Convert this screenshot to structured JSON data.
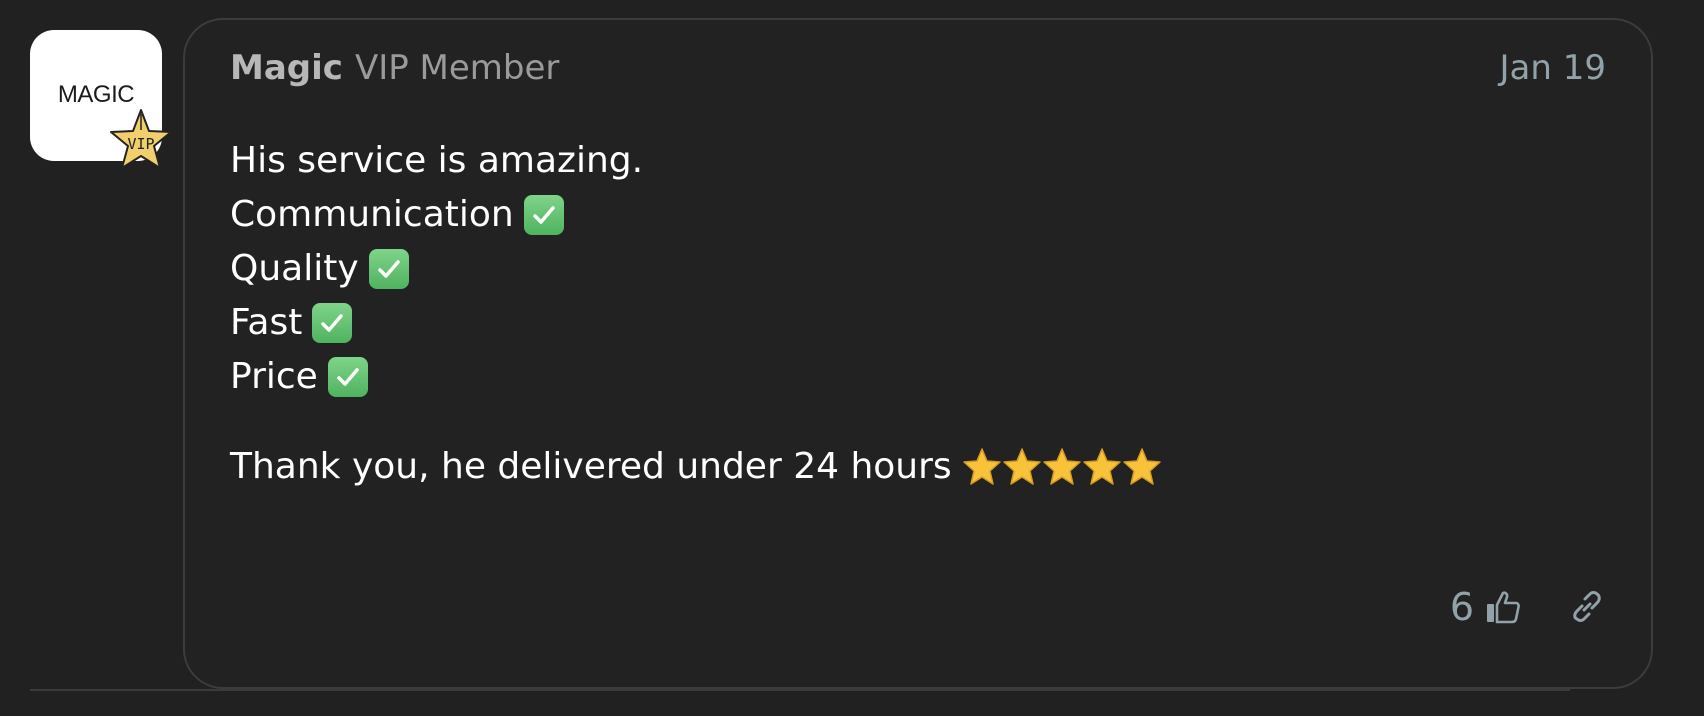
{
  "avatar": {
    "logo_text": "MAGIC",
    "badge_text": "VIP"
  },
  "post": {
    "author": "Magic",
    "member_status": "VIP Member",
    "date": "Jan 19",
    "intro": "His service is amazing.",
    "checklist": [
      {
        "label": "Communication",
        "icon": "check-mark-icon"
      },
      {
        "label": "Quality",
        "icon": "check-mark-icon"
      },
      {
        "label": "Fast",
        "icon": "check-mark-icon"
      },
      {
        "label": "Price",
        "icon": "check-mark-icon"
      }
    ],
    "closing": "Thank you, he delivered under 24 hours",
    "rating_stars": 5,
    "likes": "6"
  },
  "colors": {
    "background": "#212121",
    "card_border": "#3c3c3c",
    "muted_text": "#91a2a8",
    "check_green": "#4fb35f",
    "star_gold": "#f6c33b"
  }
}
